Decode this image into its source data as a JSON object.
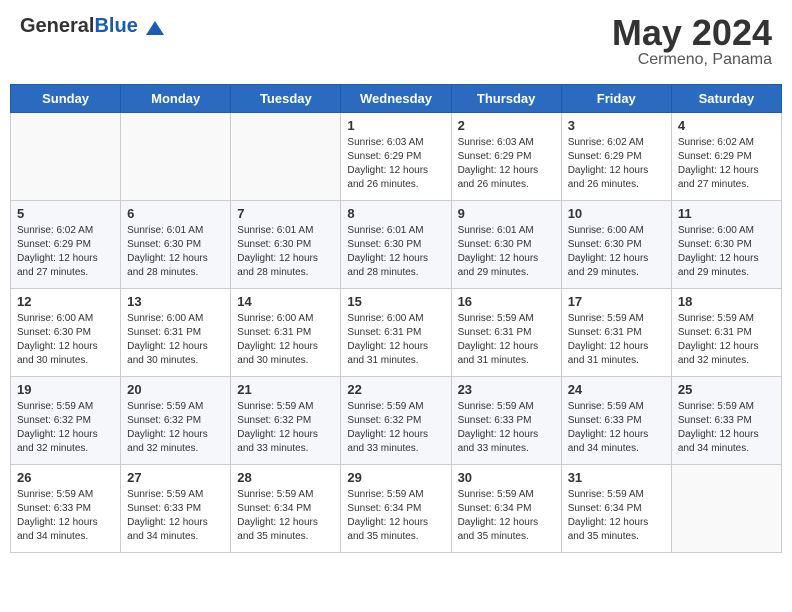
{
  "header": {
    "logo_general": "General",
    "logo_blue": "Blue",
    "month_year": "May 2024",
    "location": "Cermeno, Panama"
  },
  "days_of_week": [
    "Sunday",
    "Monday",
    "Tuesday",
    "Wednesday",
    "Thursday",
    "Friday",
    "Saturday"
  ],
  "weeks": [
    [
      {
        "day": "",
        "sunrise": "",
        "sunset": "",
        "daylight": ""
      },
      {
        "day": "",
        "sunrise": "",
        "sunset": "",
        "daylight": ""
      },
      {
        "day": "",
        "sunrise": "",
        "sunset": "",
        "daylight": ""
      },
      {
        "day": "1",
        "sunrise": "Sunrise: 6:03 AM",
        "sunset": "Sunset: 6:29 PM",
        "daylight": "Daylight: 12 hours and 26 minutes."
      },
      {
        "day": "2",
        "sunrise": "Sunrise: 6:03 AM",
        "sunset": "Sunset: 6:29 PM",
        "daylight": "Daylight: 12 hours and 26 minutes."
      },
      {
        "day": "3",
        "sunrise": "Sunrise: 6:02 AM",
        "sunset": "Sunset: 6:29 PM",
        "daylight": "Daylight: 12 hours and 26 minutes."
      },
      {
        "day": "4",
        "sunrise": "Sunrise: 6:02 AM",
        "sunset": "Sunset: 6:29 PM",
        "daylight": "Daylight: 12 hours and 27 minutes."
      }
    ],
    [
      {
        "day": "5",
        "sunrise": "Sunrise: 6:02 AM",
        "sunset": "Sunset: 6:29 PM",
        "daylight": "Daylight: 12 hours and 27 minutes."
      },
      {
        "day": "6",
        "sunrise": "Sunrise: 6:01 AM",
        "sunset": "Sunset: 6:30 PM",
        "daylight": "Daylight: 12 hours and 28 minutes."
      },
      {
        "day": "7",
        "sunrise": "Sunrise: 6:01 AM",
        "sunset": "Sunset: 6:30 PM",
        "daylight": "Daylight: 12 hours and 28 minutes."
      },
      {
        "day": "8",
        "sunrise": "Sunrise: 6:01 AM",
        "sunset": "Sunset: 6:30 PM",
        "daylight": "Daylight: 12 hours and 28 minutes."
      },
      {
        "day": "9",
        "sunrise": "Sunrise: 6:01 AM",
        "sunset": "Sunset: 6:30 PM",
        "daylight": "Daylight: 12 hours and 29 minutes."
      },
      {
        "day": "10",
        "sunrise": "Sunrise: 6:00 AM",
        "sunset": "Sunset: 6:30 PM",
        "daylight": "Daylight: 12 hours and 29 minutes."
      },
      {
        "day": "11",
        "sunrise": "Sunrise: 6:00 AM",
        "sunset": "Sunset: 6:30 PM",
        "daylight": "Daylight: 12 hours and 29 minutes."
      }
    ],
    [
      {
        "day": "12",
        "sunrise": "Sunrise: 6:00 AM",
        "sunset": "Sunset: 6:30 PM",
        "daylight": "Daylight: 12 hours and 30 minutes."
      },
      {
        "day": "13",
        "sunrise": "Sunrise: 6:00 AM",
        "sunset": "Sunset: 6:31 PM",
        "daylight": "Daylight: 12 hours and 30 minutes."
      },
      {
        "day": "14",
        "sunrise": "Sunrise: 6:00 AM",
        "sunset": "Sunset: 6:31 PM",
        "daylight": "Daylight: 12 hours and 30 minutes."
      },
      {
        "day": "15",
        "sunrise": "Sunrise: 6:00 AM",
        "sunset": "Sunset: 6:31 PM",
        "daylight": "Daylight: 12 hours and 31 minutes."
      },
      {
        "day": "16",
        "sunrise": "Sunrise: 5:59 AM",
        "sunset": "Sunset: 6:31 PM",
        "daylight": "Daylight: 12 hours and 31 minutes."
      },
      {
        "day": "17",
        "sunrise": "Sunrise: 5:59 AM",
        "sunset": "Sunset: 6:31 PM",
        "daylight": "Daylight: 12 hours and 31 minutes."
      },
      {
        "day": "18",
        "sunrise": "Sunrise: 5:59 AM",
        "sunset": "Sunset: 6:31 PM",
        "daylight": "Daylight: 12 hours and 32 minutes."
      }
    ],
    [
      {
        "day": "19",
        "sunrise": "Sunrise: 5:59 AM",
        "sunset": "Sunset: 6:32 PM",
        "daylight": "Daylight: 12 hours and 32 minutes."
      },
      {
        "day": "20",
        "sunrise": "Sunrise: 5:59 AM",
        "sunset": "Sunset: 6:32 PM",
        "daylight": "Daylight: 12 hours and 32 minutes."
      },
      {
        "day": "21",
        "sunrise": "Sunrise: 5:59 AM",
        "sunset": "Sunset: 6:32 PM",
        "daylight": "Daylight: 12 hours and 33 minutes."
      },
      {
        "day": "22",
        "sunrise": "Sunrise: 5:59 AM",
        "sunset": "Sunset: 6:32 PM",
        "daylight": "Daylight: 12 hours and 33 minutes."
      },
      {
        "day": "23",
        "sunrise": "Sunrise: 5:59 AM",
        "sunset": "Sunset: 6:33 PM",
        "daylight": "Daylight: 12 hours and 33 minutes."
      },
      {
        "day": "24",
        "sunrise": "Sunrise: 5:59 AM",
        "sunset": "Sunset: 6:33 PM",
        "daylight": "Daylight: 12 hours and 34 minutes."
      },
      {
        "day": "25",
        "sunrise": "Sunrise: 5:59 AM",
        "sunset": "Sunset: 6:33 PM",
        "daylight": "Daylight: 12 hours and 34 minutes."
      }
    ],
    [
      {
        "day": "26",
        "sunrise": "Sunrise: 5:59 AM",
        "sunset": "Sunset: 6:33 PM",
        "daylight": "Daylight: 12 hours and 34 minutes."
      },
      {
        "day": "27",
        "sunrise": "Sunrise: 5:59 AM",
        "sunset": "Sunset: 6:33 PM",
        "daylight": "Daylight: 12 hours and 34 minutes."
      },
      {
        "day": "28",
        "sunrise": "Sunrise: 5:59 AM",
        "sunset": "Sunset: 6:34 PM",
        "daylight": "Daylight: 12 hours and 35 minutes."
      },
      {
        "day": "29",
        "sunrise": "Sunrise: 5:59 AM",
        "sunset": "Sunset: 6:34 PM",
        "daylight": "Daylight: 12 hours and 35 minutes."
      },
      {
        "day": "30",
        "sunrise": "Sunrise: 5:59 AM",
        "sunset": "Sunset: 6:34 PM",
        "daylight": "Daylight: 12 hours and 35 minutes."
      },
      {
        "day": "31",
        "sunrise": "Sunrise: 5:59 AM",
        "sunset": "Sunset: 6:34 PM",
        "daylight": "Daylight: 12 hours and 35 minutes."
      },
      {
        "day": "",
        "sunrise": "",
        "sunset": "",
        "daylight": ""
      }
    ]
  ]
}
